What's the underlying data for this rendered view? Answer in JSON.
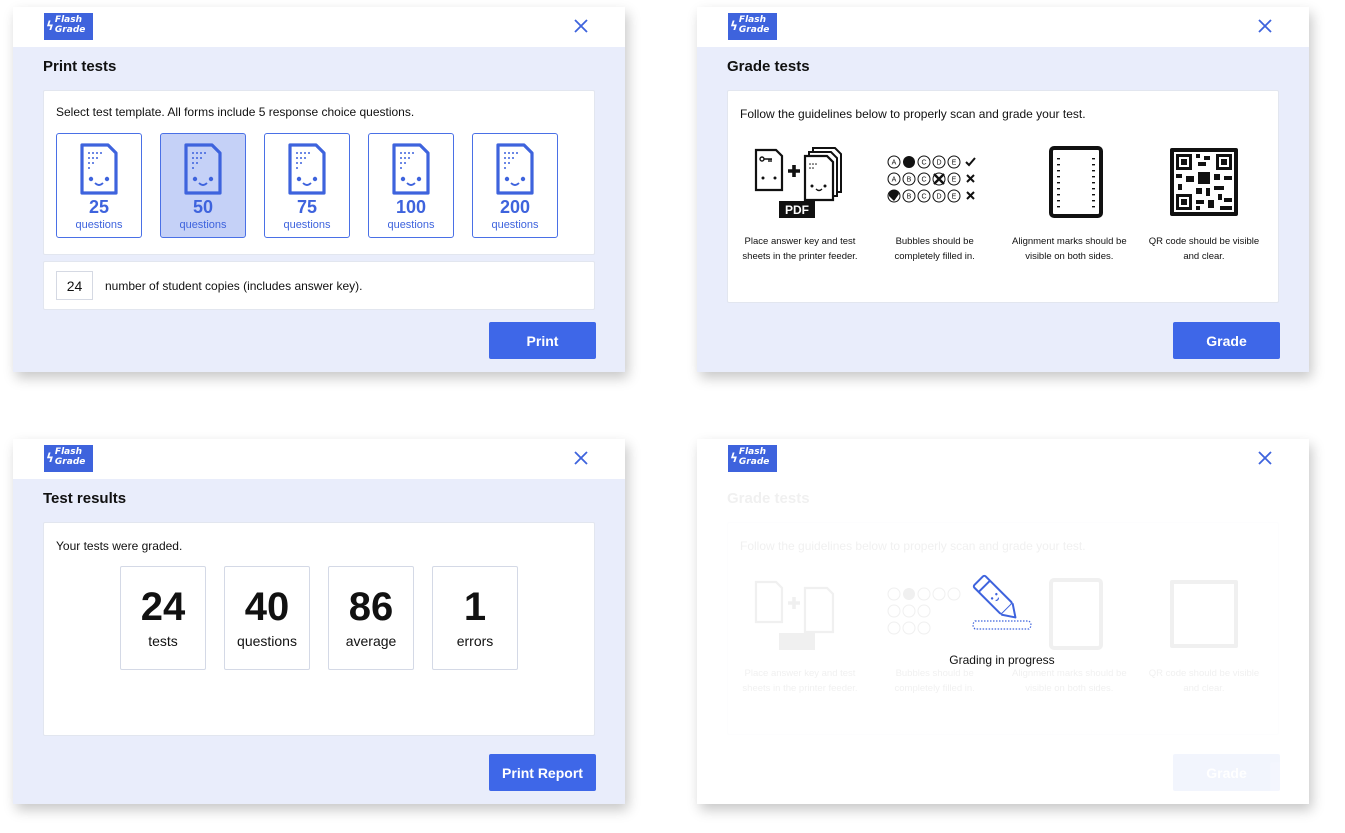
{
  "logo": {
    "line1": "Flash",
    "line2": "Grade"
  },
  "colors": {
    "accent": "#3e67e8",
    "panel_bg": "#e9edfb",
    "selected_bg": "#c5d1f7"
  },
  "print_tests": {
    "title": "Print tests",
    "instruction": "Select test template.  All forms include 5 response choice questions.",
    "templates": [
      {
        "count": "25",
        "unit": "questions"
      },
      {
        "count": "50",
        "unit": "questions",
        "selected": true
      },
      {
        "count": "75",
        "unit": "questions"
      },
      {
        "count": "100",
        "unit": "questions"
      },
      {
        "count": "200",
        "unit": "questions"
      }
    ],
    "copies_value": "24",
    "copies_label": "number of student copies (includes answer key).",
    "print_button": "Print"
  },
  "grade_tests": {
    "title": "Grade tests",
    "instruction": "Follow the guidelines below to properly scan and grade your test.",
    "pdf_badge": "PDF",
    "guidelines": [
      {
        "icon": "answer-key-sheets-icon",
        "line1": "Place answer key and test",
        "line2": "sheets in the printer feeder."
      },
      {
        "icon": "bubbles-icon",
        "line1": "Bubbles should be",
        "line2": "completely filled in."
      },
      {
        "icon": "alignment-marks-icon",
        "line1": "Alignment marks should be",
        "line2": "visible on both sides."
      },
      {
        "icon": "qr-code-icon",
        "line1": "QR code should be visible",
        "line2": "and clear."
      }
    ],
    "bubble_letters": [
      "A",
      "B",
      "C",
      "D",
      "E"
    ],
    "grade_button": "Grade"
  },
  "test_results": {
    "title": "Test results",
    "message": "Your tests were graded.",
    "stats": [
      {
        "value": "24",
        "label": "tests"
      },
      {
        "value": "40",
        "label": "questions"
      },
      {
        "value": "86",
        "label": "average"
      },
      {
        "value": "1",
        "label": "errors"
      }
    ],
    "report_button": "Print Report"
  },
  "grading_progress": {
    "status": "Grading in progress"
  }
}
